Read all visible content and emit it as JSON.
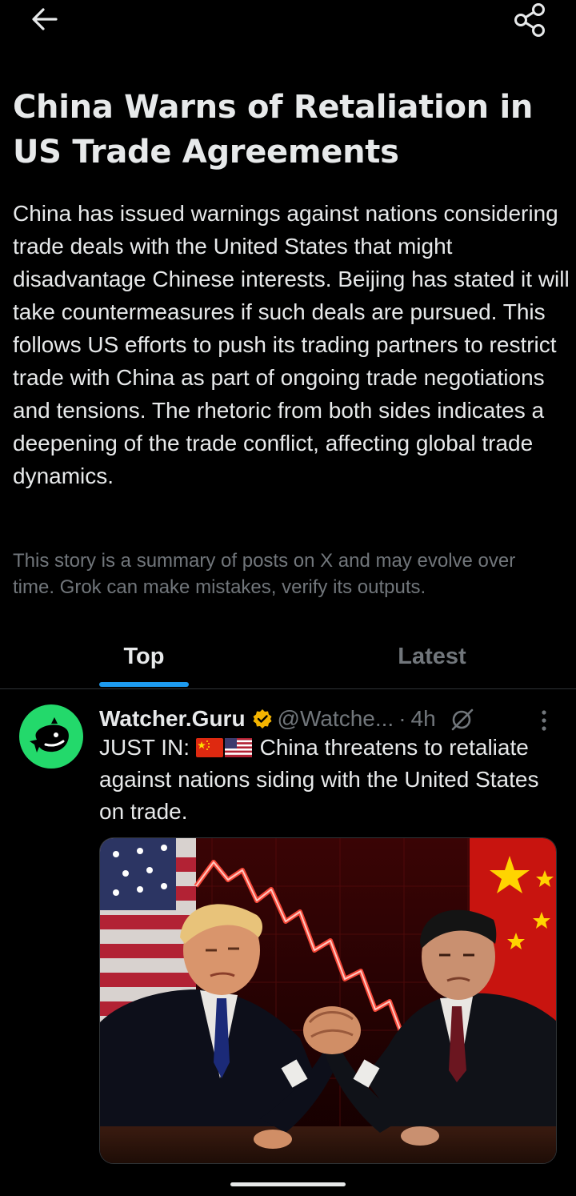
{
  "headline": "China Warns of Retaliation in US Trade Agreements",
  "summary": "China has issued warnings against nations considering trade deals with the United States that might disadvantage Chinese interests. Beijing has stated it will take countermeasures if such deals are pursued. This follows US efforts to push its trading partners to restrict trade with China as part of ongoing trade negotiations and tensions. The rhetoric from both sides indicates a deepening of the trade conflict, affecting global trade dynamics.",
  "disclaimer": "This story is a summary of posts on X and may evolve over time. Grok can make mistakes, verify its outputs.",
  "tabs": [
    {
      "label": "Top",
      "selected": true
    },
    {
      "label": "Latest",
      "selected": false
    }
  ],
  "post": {
    "display_name": "Watcher.Guru",
    "handle": "@Watche...",
    "separator": "·",
    "time": "4h",
    "text_prefix": "JUST IN:",
    "text_body": "China threatens to retaliate against nations siding with the United States on trade.",
    "flags": [
      "china-flag",
      "us-flag"
    ],
    "verified": true
  },
  "icons": {
    "back": "arrow-left-icon",
    "share": "share-icon",
    "verified": "verified-badge-icon",
    "grok": "grok-icon",
    "more": "more-vertical-icon"
  },
  "colors": {
    "background": "#000000",
    "text": "#e7e9ea",
    "muted": "#71767b",
    "accent": "#1d9bf0",
    "verified": "#f4b400",
    "avatar_bg": "#23d96b"
  }
}
